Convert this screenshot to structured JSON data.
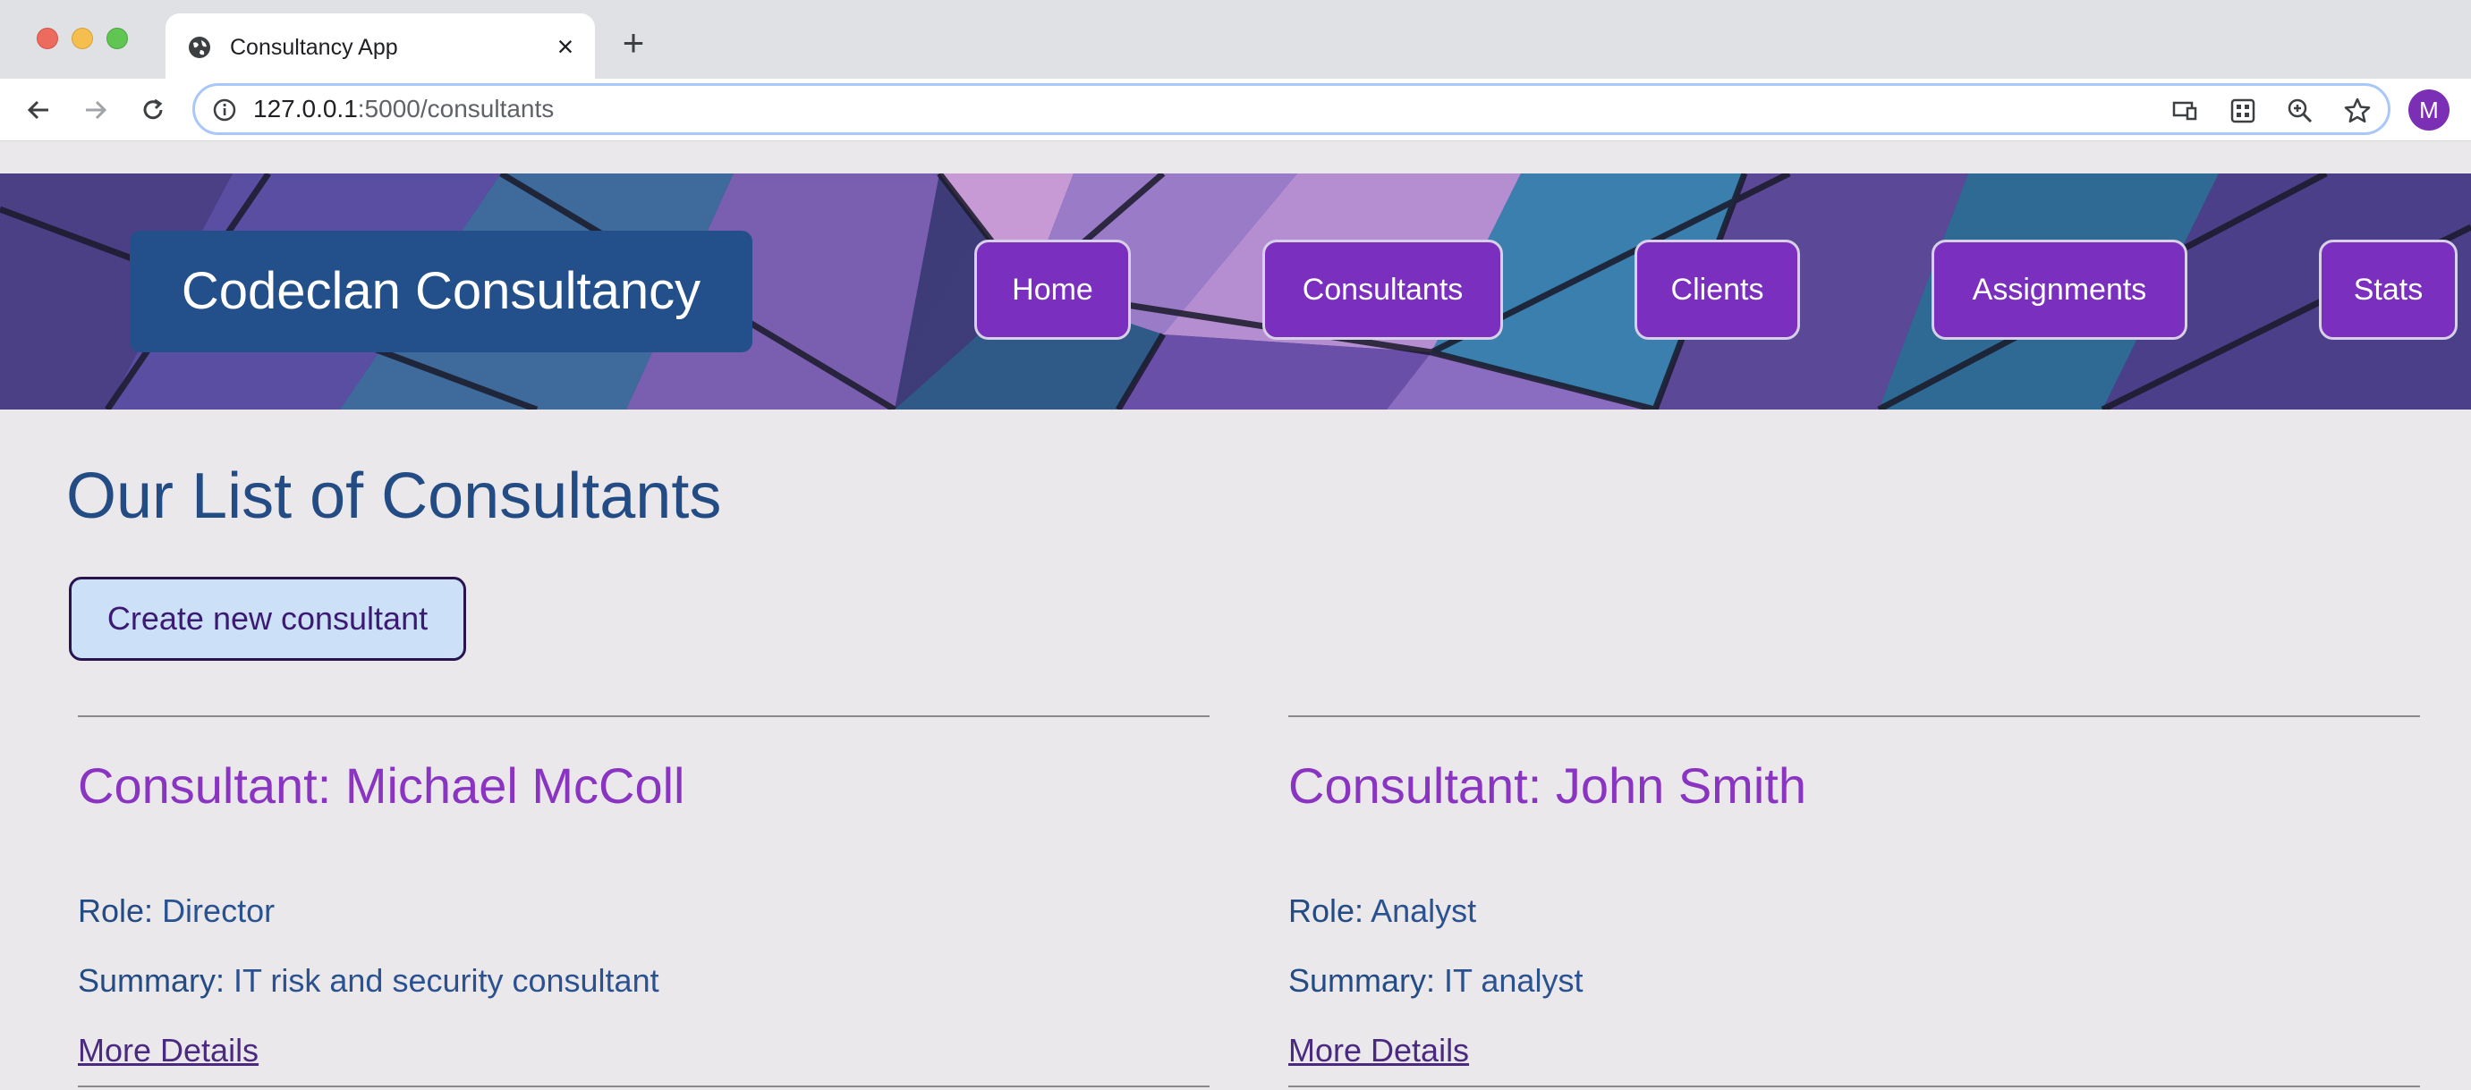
{
  "browser": {
    "tab_title": "Consultancy App",
    "url_host": "127.0.0.1",
    "url_path": ":5000/consultants",
    "avatar_initial": "M"
  },
  "header": {
    "brand": "Codeclan Consultancy",
    "nav": [
      {
        "label": "Home"
      },
      {
        "label": "Consultants"
      },
      {
        "label": "Clients"
      },
      {
        "label": "Assignments"
      },
      {
        "label": "Stats"
      }
    ]
  },
  "main": {
    "title": "Our List of Consultants",
    "create_label": "Create new consultant",
    "role_label": "Role:",
    "summary_label": "Summary:",
    "details_label": "More Details",
    "consultants": [
      {
        "heading": "Consultant: Michael McColl",
        "role": "Director",
        "summary": "IT risk and security consultant"
      },
      {
        "heading": "Consultant: John Smith",
        "role": "Analyst",
        "summary": "IT analyst"
      }
    ]
  },
  "colors": {
    "brand_bg": "#23508a",
    "nav_bg": "#7b2fbe",
    "heading": "#234b84",
    "consultant_name": "#8a35c2",
    "create_bg": "#cce0f8"
  }
}
